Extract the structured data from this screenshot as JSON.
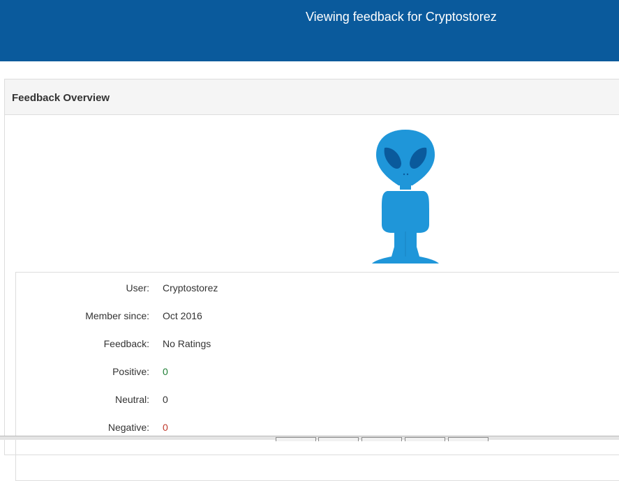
{
  "header": {
    "title": "Viewing feedback for Cryptostorez",
    "background": "#0a5a9c"
  },
  "panel": {
    "heading": "Feedback Overview"
  },
  "avatar": {
    "icon": "alien-icon",
    "color": "#1f96d9",
    "eye_color": "#0a5a9c"
  },
  "details": {
    "user_label": "User:",
    "user_value": "Cryptostorez",
    "member_since_label": "Member since:",
    "member_since_value": "Oct 2016",
    "feedback_label": "Feedback:",
    "feedback_value": "No Ratings",
    "positive_label": "Positive:",
    "positive_value": "0",
    "neutral_label": "Neutral:",
    "neutral_value": "0",
    "negative_label": "Negative:",
    "negative_value": "0"
  },
  "colors": {
    "positive": "#1e7e34",
    "negative": "#c0392b"
  }
}
